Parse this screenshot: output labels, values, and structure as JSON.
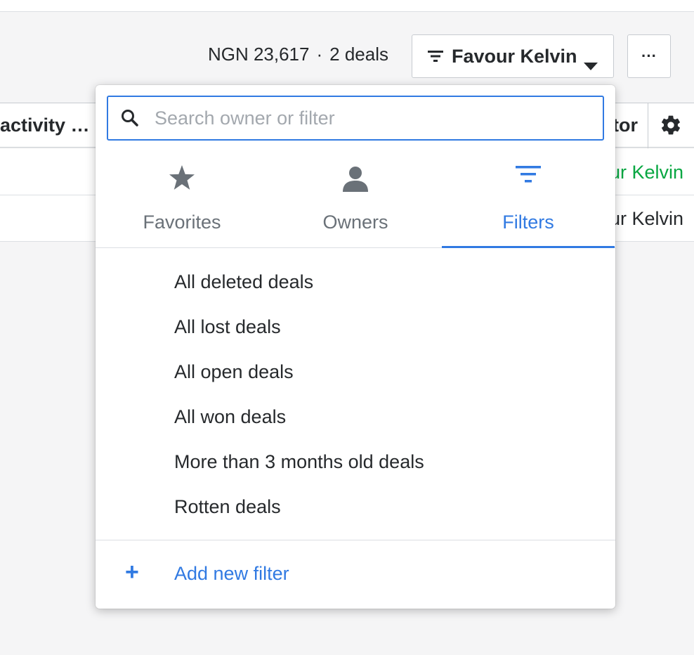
{
  "toolbar": {
    "amount": "NGN 23,617",
    "separator": "·",
    "deal_count": "2 deals",
    "owner_selector_label": "Favour Kelvin",
    "more_label": "···"
  },
  "table": {
    "columns": {
      "activity": "activity …",
      "creator": "tor"
    },
    "rows": [
      {
        "owner": "ur Kelvin"
      },
      {
        "owner": "ur Kelvin"
      }
    ]
  },
  "popover": {
    "search": {
      "placeholder": "Search owner or filter",
      "value": ""
    },
    "tabs": [
      {
        "label": "Favorites",
        "icon": "star-icon"
      },
      {
        "label": "Owners",
        "icon": "person-icon"
      },
      {
        "label": "Filters",
        "icon": "filter-icon",
        "active": true
      }
    ],
    "filters": [
      "All deleted deals",
      "All lost deals",
      "All open deals",
      "All won deals",
      "More than 3 months old deals",
      "Rotten deals"
    ],
    "add_filter_label": "Add new filter",
    "add_icon": "+"
  },
  "colors": {
    "accent": "#317ae2",
    "success_text": "#08a742",
    "text": "#26292c",
    "muted": "#6a7178"
  }
}
